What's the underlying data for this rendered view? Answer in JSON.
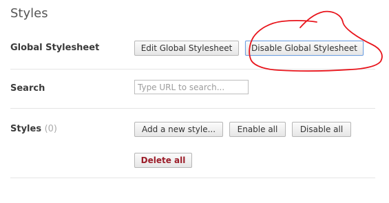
{
  "page": {
    "title": "Styles"
  },
  "global_stylesheet": {
    "label": "Global Stylesheet",
    "edit_button": "Edit Global Stylesheet",
    "disable_button": "Disable Global Stylesheet"
  },
  "search": {
    "label": "Search",
    "placeholder": "Type URL to search...",
    "value": ""
  },
  "styles": {
    "label": "Styles",
    "count": "(0)",
    "add_button": "Add a new style...",
    "enable_all_button": "Enable all",
    "disable_all_button": "Disable all",
    "delete_all_button": "Delete all"
  },
  "colors": {
    "annotation": "#e8141b",
    "focus_border": "#6d9fe0",
    "danger_text": "#9b1c28"
  }
}
